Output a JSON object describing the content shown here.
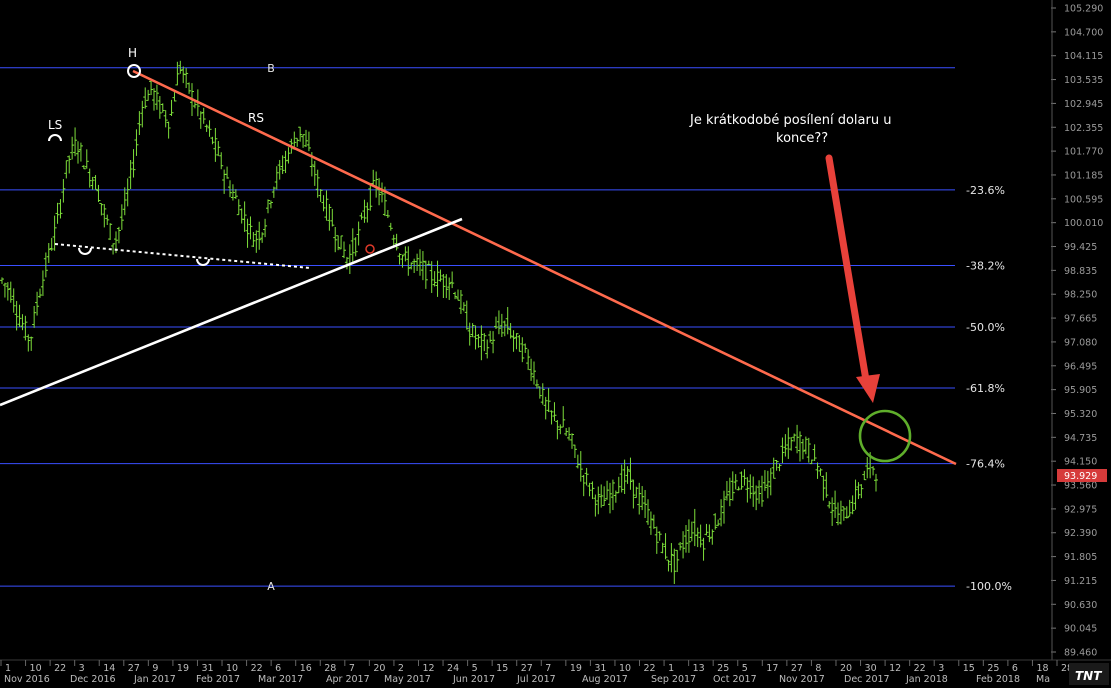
{
  "chart_data": {
    "type": "ohlc",
    "instrument_price_label": "93.929",
    "colors": {
      "background": "#000000",
      "bars": "#7dde3a",
      "fib_lines": "#3a4fff",
      "trendline_down": "#ff6a4d",
      "trendline_up": "#ffffff",
      "dotted_neckline": "#ffffff",
      "arrow": "#e8413a",
      "circle": "#5fae2b",
      "price_tag_bg": "#d63b3b"
    },
    "y_axis": {
      "min": 89.46,
      "max": 105.29,
      "ticks": [
        "105.290",
        "104.700",
        "104.115",
        "103.535",
        "102.945",
        "102.355",
        "101.770",
        "101.185",
        "100.595",
        "100.010",
        "99.425",
        "98.835",
        "98.250",
        "97.665",
        "97.080",
        "96.495",
        "95.905",
        "95.320",
        "94.735",
        "94.150",
        "93.560",
        "92.975",
        "92.390",
        "91.805",
        "91.215",
        "90.630",
        "90.045",
        "89.460"
      ]
    },
    "x_axis": {
      "day_ticks": [
        "1",
        "10",
        "22",
        "3",
        "14",
        "27",
        "9",
        "19",
        "31",
        "10",
        "22",
        "6",
        "16",
        "28",
        "7",
        "20",
        "2",
        "12",
        "24",
        "5",
        "15",
        "27",
        "7",
        "19",
        "31",
        "10",
        "22",
        "1",
        "13",
        "25",
        "5",
        "17",
        "27",
        "8",
        "20",
        "30",
        "12",
        "22",
        "3",
        "15",
        "25",
        "6",
        "18",
        "28"
      ],
      "months": [
        "Nov 2016",
        "Dec 2016",
        "Jan 2017",
        "Feb 2017",
        "Mar 2017",
        "Apr 2017",
        "May 2017",
        "Jun 2017",
        "Jul 2017",
        "Aug 2017",
        "Sep 2017",
        "Oct 2017",
        "Nov 2017",
        "Dec 2017",
        "Jan 2018",
        "Feb 2018",
        "Ma"
      ]
    },
    "fib_levels": [
      {
        "label": "B",
        "price": 103.82
      },
      {
        "label": "-23.6%",
        "price": 100.82
      },
      {
        "label": "-38.2%",
        "price": 98.96
      },
      {
        "label": "-50.0%",
        "price": 97.45
      },
      {
        "label": "-61.8%",
        "price": 95.95
      },
      {
        "label": "-76.4%",
        "price": 94.09
      },
      {
        "label": "A",
        "price": 91.08
      },
      {
        "label": "-100.0%",
        "price": 91.08
      }
    ],
    "pattern_labels": [
      "LS",
      "H",
      "RS"
    ],
    "annotation": {
      "line1": "Je krátkodobé posílení dolaru u",
      "line2": "konce??"
    },
    "logo": "TNT",
    "series_path": [
      [
        0,
        98.6
      ],
      [
        2,
        98.3
      ],
      [
        4,
        97.6
      ],
      [
        6,
        97.1
      ],
      [
        8,
        98.3
      ],
      [
        10,
        99.2
      ],
      [
        12,
        100.1
      ],
      [
        14,
        101.5
      ],
      [
        16,
        102.0
      ],
      [
        18,
        101.4
      ],
      [
        20,
        101.0
      ],
      [
        22,
        100.2
      ],
      [
        24,
        99.5
      ],
      [
        26,
        100.2
      ],
      [
        28,
        101.4
      ],
      [
        30,
        102.9
      ],
      [
        32,
        103.3
      ],
      [
        34,
        102.8
      ],
      [
        36,
        102.5
      ],
      [
        38,
        103.9
      ],
      [
        40,
        103.3
      ],
      [
        42,
        102.8
      ],
      [
        44,
        102.3
      ],
      [
        46,
        101.8
      ],
      [
        48,
        101.1
      ],
      [
        50,
        100.6
      ],
      [
        52,
        100.1
      ],
      [
        54,
        99.6
      ],
      [
        56,
        99.9
      ],
      [
        58,
        100.9
      ],
      [
        60,
        101.4
      ],
      [
        62,
        101.9
      ],
      [
        64,
        102.3
      ],
      [
        66,
        101.6
      ],
      [
        68,
        100.8
      ],
      [
        70,
        100.2
      ],
      [
        72,
        99.6
      ],
      [
        74,
        99.1
      ],
      [
        76,
        99.6
      ],
      [
        78,
        100.4
      ],
      [
        80,
        101.0
      ],
      [
        82,
        100.4
      ],
      [
        84,
        99.7
      ],
      [
        86,
        99.1
      ],
      [
        88,
        99.0
      ],
      [
        90,
        98.9
      ],
      [
        92,
        98.7
      ],
      [
        94,
        98.6
      ],
      [
        96,
        98.6
      ],
      [
        98,
        98.1
      ],
      [
        100,
        97.4
      ],
      [
        102,
        97.1
      ],
      [
        104,
        97.0
      ],
      [
        106,
        97.4
      ],
      [
        108,
        97.5
      ],
      [
        110,
        97.1
      ],
      [
        112,
        96.8
      ],
      [
        114,
        96.3
      ],
      [
        116,
        95.6
      ],
      [
        118,
        95.2
      ],
      [
        120,
        95.0
      ],
      [
        122,
        94.6
      ],
      [
        124,
        93.9
      ],
      [
        126,
        93.5
      ],
      [
        128,
        93.1
      ],
      [
        130,
        93.3
      ],
      [
        132,
        93.6
      ],
      [
        134,
        93.8
      ],
      [
        136,
        93.3
      ],
      [
        138,
        92.9
      ],
      [
        140,
        92.4
      ],
      [
        142,
        91.9
      ],
      [
        144,
        91.6
      ],
      [
        146,
        92.2
      ],
      [
        148,
        92.5
      ],
      [
        150,
        92.2
      ],
      [
        152,
        92.5
      ],
      [
        154,
        92.9
      ],
      [
        156,
        93.4
      ],
      [
        158,
        93.7
      ],
      [
        160,
        93.6
      ],
      [
        162,
        93.3
      ],
      [
        164,
        93.6
      ],
      [
        166,
        94.1
      ],
      [
        168,
        94.5
      ],
      [
        170,
        94.7
      ],
      [
        172,
        94.5
      ],
      [
        174,
        94.2
      ],
      [
        176,
        93.6
      ],
      [
        178,
        92.9
      ],
      [
        180,
        92.8
      ],
      [
        182,
        93.1
      ],
      [
        184,
        93.6
      ],
      [
        186,
        94.1
      ],
      [
        187,
        93.9
      ]
    ],
    "ohlc_mode": "synthesized-from-series-path"
  }
}
